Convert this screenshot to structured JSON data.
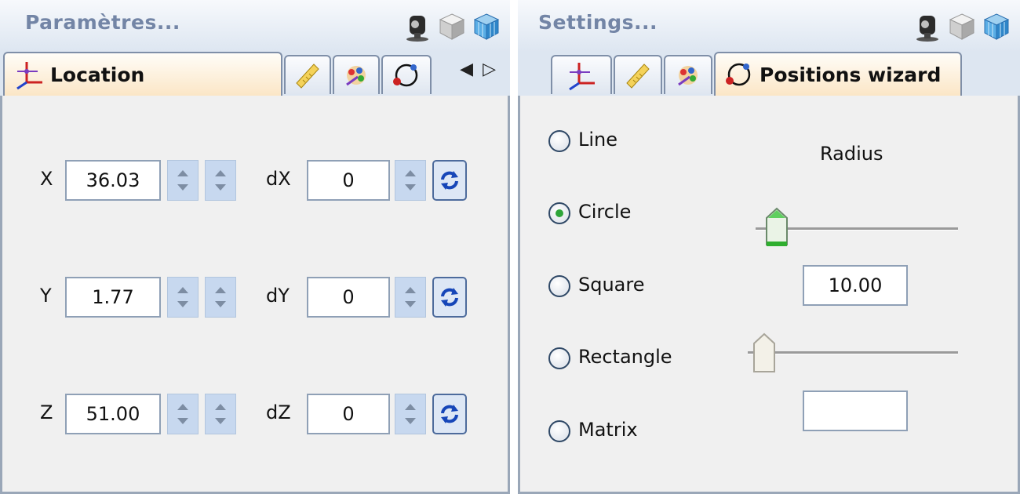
{
  "left": {
    "title": "Paramètres...",
    "active_tab": "Location",
    "rows": [
      {
        "label": "X",
        "value": "36.03",
        "delta_label": "dX",
        "delta_value": "0"
      },
      {
        "label": "Y",
        "value": "1.77",
        "delta_label": "dY",
        "delta_value": "0"
      },
      {
        "label": "Z",
        "value": "51.00",
        "delta_label": "dZ",
        "delta_value": "0"
      }
    ]
  },
  "right": {
    "title": "Settings...",
    "active_tab": "Positions wizard",
    "options": [
      "Line",
      "Circle",
      "Square",
      "Rectangle",
      "Matrix"
    ],
    "selected_option": "Circle",
    "radius_label": "Radius",
    "radius_value": "10.00",
    "second_value": ""
  },
  "icons": {
    "title": [
      "light-icon",
      "cube-icon",
      "grid-cube-icon"
    ],
    "tabs": [
      "axes-icon",
      "ruler-icon",
      "paint-icon",
      "positions-icon"
    ],
    "nav": [
      "arrow-left-icon",
      "arrow-right-icon"
    ]
  },
  "colors": {
    "title_text": "#7385a6",
    "active_tab": "#fbe6c6",
    "spin_button": "#c7d8ef",
    "radio_selected": "#2ea53a"
  }
}
